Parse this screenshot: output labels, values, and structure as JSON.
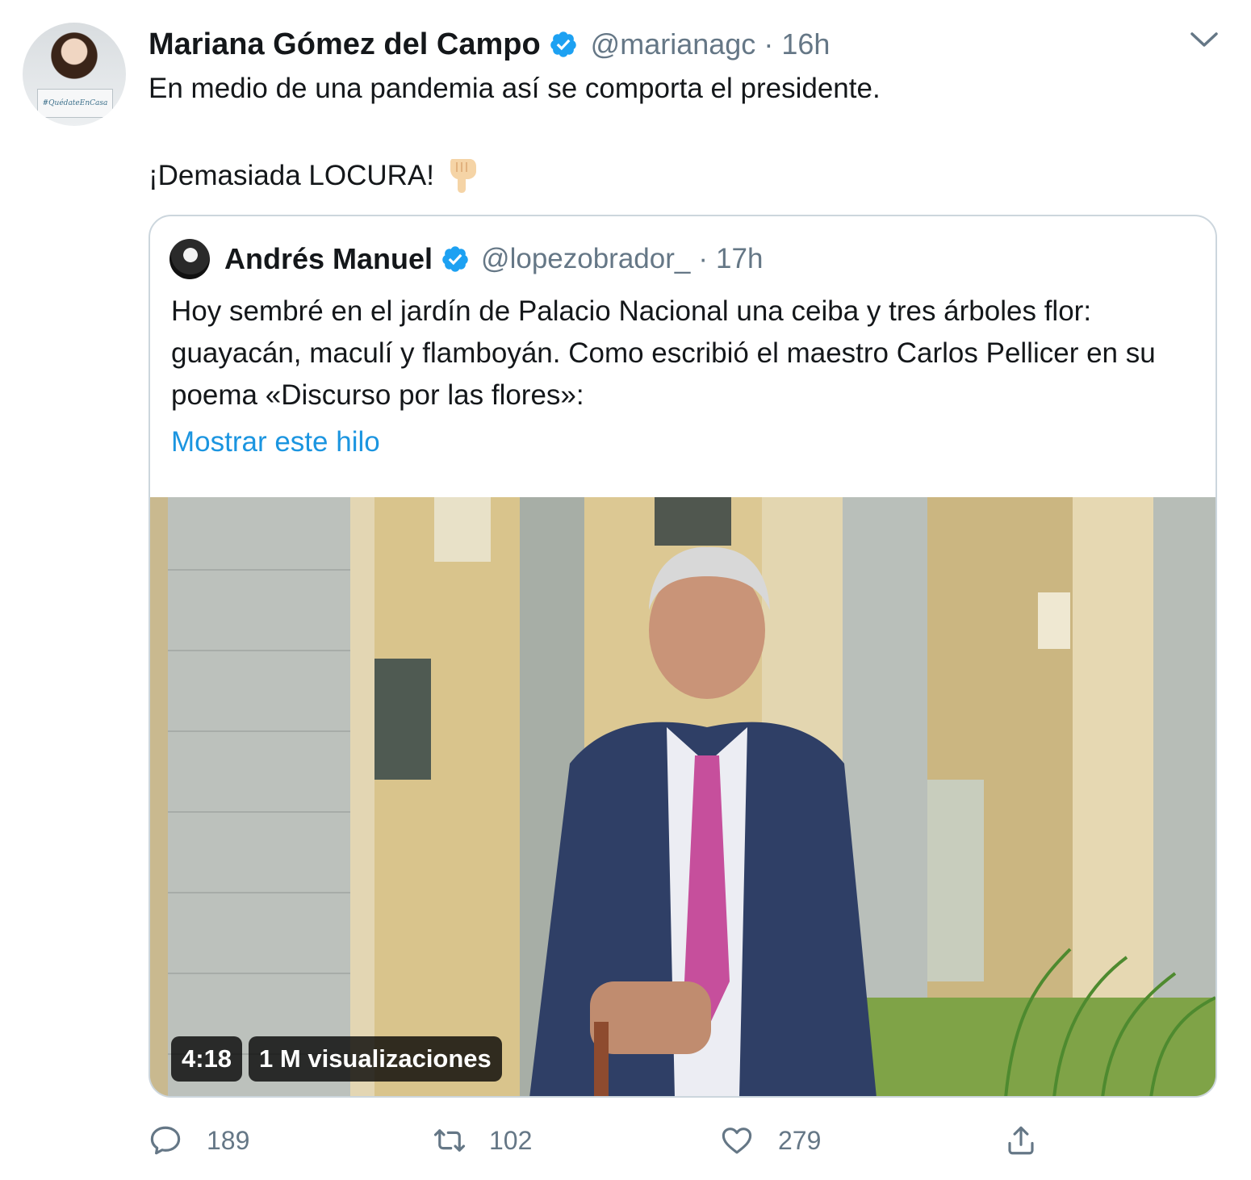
{
  "tweet": {
    "author_name": "Mariana Gómez del Campo",
    "author_handle": "@marianagc",
    "separator": "·",
    "time": "16h",
    "avatar_sign": "#QuédateEnCasa",
    "text_line1": "En medio de una pandemia así se comporta el presidente.",
    "text_line2": "¡Demasiada LOCURA!",
    "emoji": "backhand-index-pointing-down-icon"
  },
  "quoted": {
    "author_name": "Andrés Manuel",
    "author_handle": "@lopezobrador_",
    "separator": "·",
    "time": "17h",
    "text": "Hoy sembré en el jardín de Palacio Nacional una ceiba y tres árboles flor: guayacán, maculí y flamboyán. Como escribió el maestro Carlos Pellicer en su poema «Discurso por las flores»:",
    "show_thread": "Mostrar este hilo",
    "video_duration": "4:18",
    "video_views": "1 M visualizaciones"
  },
  "actions": {
    "replies": "189",
    "retweets": "102",
    "likes": "279"
  },
  "colors": {
    "verified": "#1da1f2",
    "link": "#1b95e0",
    "secondary_text": "#657786",
    "border": "#ccd6dd"
  }
}
